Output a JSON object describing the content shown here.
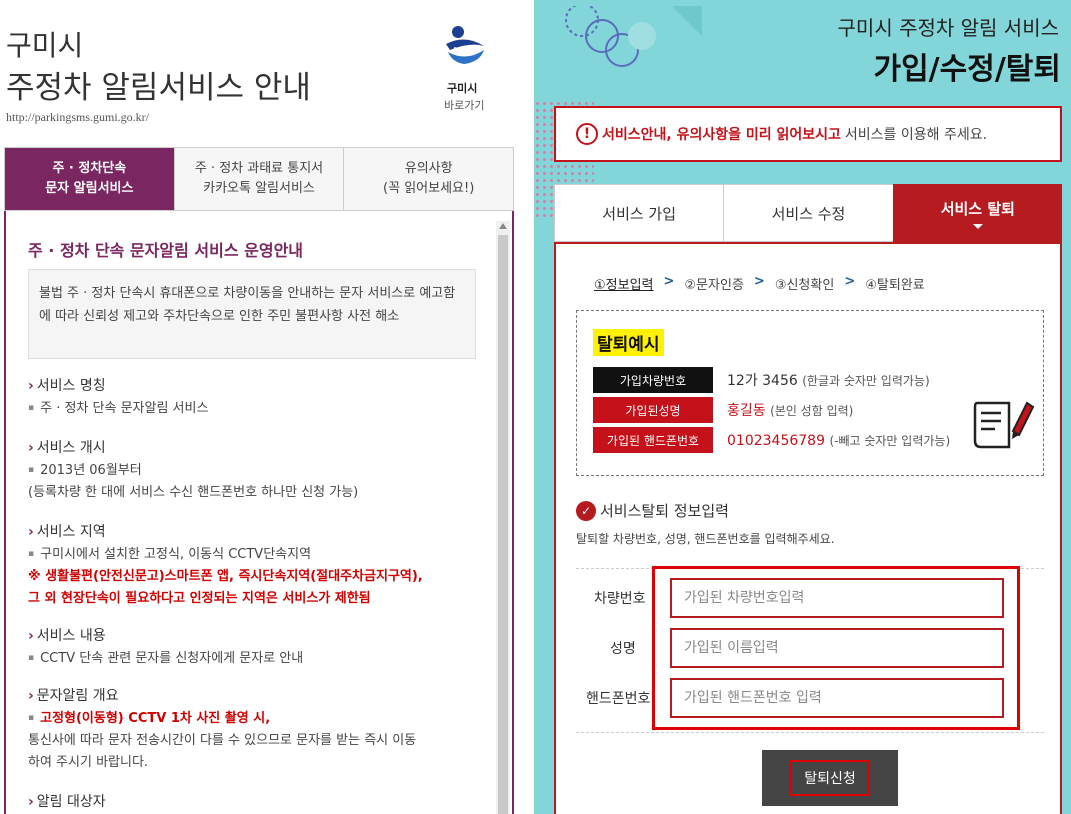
{
  "left": {
    "title_line1": "구미시",
    "title_line2": "주정차 알림서비스 안내",
    "url": "http://parkingsms.gumi.go.kr/",
    "logo_name": "구미시",
    "logo_link": "바로가기",
    "tabs": [
      {
        "line1": "주 · 정차단속",
        "line2": "문자 알림서비스",
        "active": true
      },
      {
        "line1": "주 · 정차 과태료 통지서",
        "line2": "카카오톡 알림서비스",
        "active": false
      },
      {
        "line1": "유의사항",
        "line2": "(꼭 읽어보세요!)",
        "active": false
      }
    ],
    "heading": "주 · 정차 단속 문자알림 서비스 운영안내",
    "intro": "불법 주 · 정차 단속시 휴대폰으로 차량이동을 안내하는 문자 서비스로 예고함에 따라 신뢰성 제고와 주차단속으로 인한 주민 불편사항 사전 해소",
    "sections": [
      {
        "title": "서비스 명칭",
        "item": "주 · 정차 단속 문자알림 서비스"
      },
      {
        "title": "서비스 개시",
        "item": "2013년 06월부터",
        "extra": "(등록차량 한 대에 서비스 수신 핸드폰번호 하나만 신청 가능)"
      },
      {
        "title": "서비스 지역",
        "item": "구미시에서 설치한 고정식, 이동식 CCTV단속지역",
        "red1": "※ 생활불편(안전신문고)스마트폰 앱, 즉시단속지역(절대주차금지구역),",
        "red2": "그 외 현장단속이 필요하다고 인정되는 지역은 서비스가 제한됨"
      },
      {
        "title": "서비스 내용",
        "item": "CCTV 단속 관련 문자를 신청자에게 문자로 안내"
      },
      {
        "title": "문자알림 개요",
        "item_red": "고정형(이동형) CCTV 1차 사진 촬영 시,",
        "extra1": "통신사에 따라 문자 전송시간이 다를 수 있으므로 문자를 받는 즉시 이동",
        "extra2": "하여 주시기 바랍니다."
      },
      {
        "title": "알림 대상자"
      }
    ]
  },
  "right": {
    "title_small": "구미시 주정차 알림 서비스",
    "title_big": "가입/수정/탈퇴",
    "notice_red": "서비스안내, 유의사항을 미리 읽어보시고",
    "notice_rest": "서비스를 이용해 주세요.",
    "tabs": [
      "서비스 가입",
      "서비스 수정",
      "서비스 탈퇴"
    ],
    "steps": [
      "①정보입력",
      "②문자인증",
      "③신청확인",
      "④탈퇴완료"
    ],
    "step_sep": ">",
    "example": {
      "title": "탈퇴예시",
      "rows": [
        {
          "label": "가입차량번호",
          "value": "12가 3456",
          "note": "(한글과 숫자만 입력가능)",
          "label_bg": "#111111",
          "value_red": false
        },
        {
          "label": "가입된성명",
          "value": "홍길동",
          "note": "(본인 성함 입력)",
          "label_bg": "#c5121a",
          "value_red": true
        },
        {
          "label": "가입된 핸드폰번호",
          "value": "01023456789",
          "note": "(-빼고 숫자만 입력가능)",
          "label_bg": "#c5121a",
          "value_red": true
        }
      ]
    },
    "section_title": "서비스탈퇴 정보입력",
    "section_desc": "탈퇴할 차량번호, 성명, 핸드폰번호를 입력해주세요.",
    "form": {
      "car_label": "차량번호",
      "car_placeholder": "가입된 차량번호입력",
      "name_label": "성명",
      "name_placeholder": "가입된 이름입력",
      "phone_label": "핸드폰번호",
      "phone_placeholder": "가입된 핸드폰번호 입력"
    },
    "submit_label": "탈퇴신청"
  },
  "colors": {
    "purple": "#7a2660",
    "red": "#b51b1f",
    "teal": "#82d5d8",
    "highlight": "#fff100"
  }
}
